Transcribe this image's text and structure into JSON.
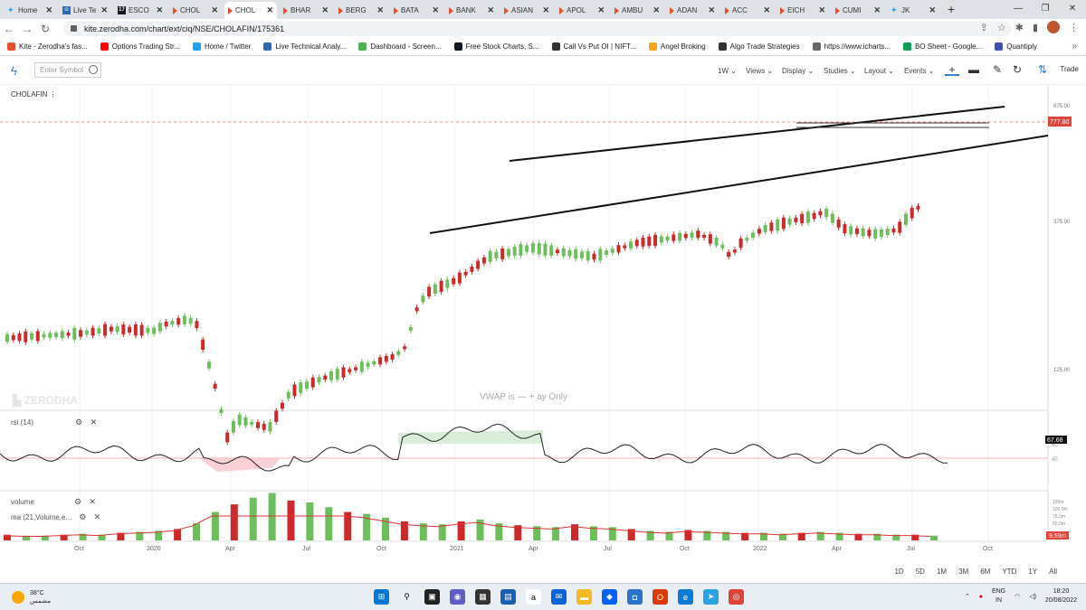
{
  "browser": {
    "tabs": [
      {
        "label": "Home",
        "icon": "twitter-icon",
        "active": false
      },
      {
        "label": "Live Te",
        "icon": "chartink-icon",
        "active": false
      },
      {
        "label": "ESCO",
        "icon": "tradingview-icon",
        "active": false
      },
      {
        "label": "CHOL",
        "icon": "kite-icon",
        "active": false
      },
      {
        "label": "CHOL",
        "icon": "kite-icon",
        "active": true
      },
      {
        "label": "BHAR",
        "icon": "kite-icon",
        "active": false
      },
      {
        "label": "BERG",
        "icon": "kite-icon",
        "active": false
      },
      {
        "label": "BATA",
        "icon": "kite-icon",
        "active": false
      },
      {
        "label": "BANK",
        "icon": "kite-icon",
        "active": false
      },
      {
        "label": "ASIAN",
        "icon": "kite-icon",
        "active": false
      },
      {
        "label": "APOL",
        "icon": "kite-icon",
        "active": false
      },
      {
        "label": "AMBU",
        "icon": "kite-icon",
        "active": false
      },
      {
        "label": "ADAN",
        "icon": "kite-icon",
        "active": false
      },
      {
        "label": "ACC",
        "icon": "kite-icon",
        "active": false
      },
      {
        "label": "EICH",
        "icon": "kite-icon",
        "active": false
      },
      {
        "label": "CUMI",
        "icon": "kite-icon",
        "active": false
      },
      {
        "label": "JK",
        "icon": "twitter-icon",
        "active": false
      }
    ],
    "url": "kite.zerodha.com/chart/ext/ciq/NSE/CHOLAFIN/175361",
    "bookmarks": [
      {
        "label": "Kite - Zerodha's fas...",
        "icon": "kite-icon",
        "color": "#e4502b"
      },
      {
        "label": "Options Trading Str...",
        "icon": "youtube-icon",
        "color": "#ff0000"
      },
      {
        "label": "Home / Twitter",
        "icon": "twitter-icon",
        "color": "#1da1f2"
      },
      {
        "label": "Live Technical Analy...",
        "icon": "chartink-icon",
        "color": "#2b6cb0"
      },
      {
        "label": "Dashboard - Screen...",
        "icon": "screener-icon",
        "color": "#4caf50"
      },
      {
        "label": "Free Stock Charts, S...",
        "icon": "tradingview-icon",
        "color": "#131722"
      },
      {
        "label": "Call Vs Put OI | NIFT...",
        "icon": "globe-icon",
        "color": "#333333"
      },
      {
        "label": "Angel Broking",
        "icon": "angel-icon",
        "color": "#f5a623"
      },
      {
        "label": "Algo Trade Strategies",
        "icon": "algo-icon",
        "color": "#333333"
      },
      {
        "label": "https://www.icharts...",
        "icon": "icharts-icon",
        "color": "#666666"
      },
      {
        "label": "BO Sheet - Google...",
        "icon": "sheets-icon",
        "color": "#0f9d58"
      },
      {
        "label": "Quantiply",
        "icon": "quantiply-icon",
        "color": "#3f51b5"
      }
    ]
  },
  "toolbar": {
    "search_placeholder": "Enter Symbol",
    "interval": "1W",
    "views": "Views",
    "display": "Display",
    "studies": "Studies",
    "layout": "Layout",
    "events": "Events",
    "trade": "Trade"
  },
  "chart": {
    "symbol": "CHOLAFIN",
    "watermark": "ZERODHA",
    "vwap_notice": "VWAP is — + ay Only",
    "price_label": "777.80",
    "rsi_label": "67.68",
    "volume_label": "9.59m",
    "colors": {
      "up": "#6cbf5c",
      "down": "#cc2a2a",
      "accent": "#387ed1",
      "price_tag": "#e1453a"
    }
  },
  "panels": {
    "rsi_title": "rsi (14)",
    "volume_title": "volume",
    "ma_title": "ma (21,Volume,e..."
  },
  "ranges": [
    "1D",
    "5D",
    "1M",
    "3M",
    "6M",
    "YTD",
    "1Y",
    "All"
  ],
  "chart_data": {
    "type": "candlestick",
    "title": "CHOLAFIN",
    "price_axis_ticks": [
      "875.00",
      "375.00",
      "125.00"
    ],
    "rsi_axis_ticks": [
      "60",
      "40"
    ],
    "volume_axis_ticks": [
      "125m",
      "100.0m",
      "75.0m",
      "50.0m"
    ],
    "x_ticks": [
      "Oct",
      "2020",
      "Apr",
      "Jul",
      "Oct",
      "2021",
      "Apr",
      "Jul",
      "Oct",
      "2022",
      "Apr",
      "Jul",
      "Oct"
    ],
    "last_price": 777.8,
    "last_rsi": 67.68,
    "last_volume": "9.59m",
    "price_path": [
      [
        0,
        280
      ],
      [
        0.07,
        275
      ],
      [
        0.1,
        270
      ],
      [
        0.14,
        272
      ],
      [
        0.15,
        265
      ],
      [
        0.17,
        260
      ],
      [
        0.18,
        262
      ],
      [
        0.19,
        300
      ],
      [
        0.2,
        340
      ],
      [
        0.21,
        390
      ],
      [
        0.22,
        370
      ],
      [
        0.25,
        380
      ],
      [
        0.27,
        340
      ],
      [
        0.3,
        325
      ],
      [
        0.33,
        315
      ],
      [
        0.37,
        300
      ],
      [
        0.38,
        290
      ],
      [
        0.39,
        250
      ],
      [
        0.4,
        230
      ],
      [
        0.43,
        215
      ],
      [
        0.46,
        190
      ],
      [
        0.5,
        180
      ],
      [
        0.53,
        185
      ],
      [
        0.56,
        190
      ],
      [
        0.6,
        175
      ],
      [
        0.63,
        170
      ],
      [
        0.66,
        165
      ],
      [
        0.68,
        175
      ],
      [
        0.69,
        190
      ],
      [
        0.7,
        175
      ],
      [
        0.72,
        160
      ],
      [
        0.75,
        150
      ],
      [
        0.77,
        145
      ],
      [
        0.78,
        140
      ],
      [
        0.8,
        160
      ],
      [
        0.83,
        165
      ],
      [
        0.85,
        160
      ],
      [
        0.86,
        145
      ],
      [
        0.87,
        135
      ]
    ],
    "volume_bars": [
      6,
      5,
      5,
      6,
      7,
      6,
      8,
      9,
      10,
      12,
      18,
      30,
      38,
      45,
      50,
      42,
      40,
      35,
      30,
      28,
      24,
      20,
      18,
      17,
      20,
      22,
      18,
      16,
      15,
      14,
      17,
      15,
      14,
      12,
      10,
      9,
      11,
      10,
      9,
      8,
      8,
      7,
      8,
      9,
      8,
      7,
      7,
      6,
      6,
      5
    ]
  },
  "taskbar": {
    "temperature": "38°C",
    "weather_label": "مشمس",
    "language": "ENG",
    "region": "IN",
    "time": "18:20",
    "date": "20/08/2022"
  }
}
